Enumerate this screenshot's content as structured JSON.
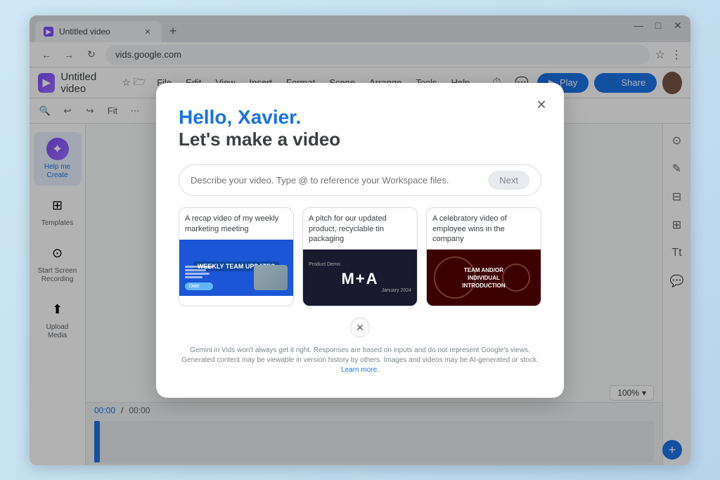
{
  "browser": {
    "tab_title": "Untitled video",
    "tab_favicon": "▶",
    "address": "vids.google.com",
    "new_tab_icon": "+",
    "minimize": "—",
    "maximize": "□",
    "close": "✕",
    "back": "←",
    "forward": "→",
    "refresh": "↻",
    "star_icon": "☆",
    "more_icon": "⋮"
  },
  "app": {
    "logo_text": "▶",
    "title": "Untitled video",
    "history_icon": "⏱",
    "comments_icon": "💬",
    "play_label": "Play",
    "share_label": "Share",
    "menu_items": [
      "File",
      "Edit",
      "View",
      "Insert",
      "Format",
      "Scene",
      "Arrange",
      "Tools",
      "Help"
    ]
  },
  "format_bar": {
    "undo_icon": "↩",
    "redo_icon": "↪",
    "fit_label": "Fit"
  },
  "sidebar": {
    "items": [
      {
        "id": "help-create",
        "label": "Help me\nCreate",
        "icon": "✦",
        "active": true
      },
      {
        "id": "templates",
        "label": "Templates",
        "icon": "⊞",
        "active": false
      },
      {
        "id": "screen-recording",
        "label": "Start Screen\nRecording",
        "icon": "⊙",
        "active": false
      },
      {
        "id": "upload-media",
        "label": "Upload\nMedia",
        "icon": "⬆",
        "active": false
      }
    ]
  },
  "right_sidebar": {
    "buttons": [
      "⊙",
      "✎",
      "⊟",
      "⊞",
      "Tt",
      "💬"
    ]
  },
  "timeline": {
    "current_time": "00:00",
    "total_time": "00:00",
    "zoom_level": "100%",
    "add_icon": "+"
  },
  "dialog": {
    "close_icon": "✕",
    "greeting": "Hello, Xavier.",
    "subtitle": "Let's make a video",
    "input_placeholder": "Describe your video. Type @ to reference your Workspace files.",
    "next_button": "Next",
    "suggestions": [
      {
        "label": "A recap video of my weekly marketing meeting",
        "thumb_type": "weekly-updates"
      },
      {
        "label": "A pitch for our updated product, recyclable tin packaging",
        "thumb_type": "product-demo"
      },
      {
        "label": "A celebratory video of employee wins in the company",
        "thumb_type": "team-intro"
      }
    ],
    "carousel_x_icon": "✕",
    "disclaimer": "Gemini in Vids won't always get it right. Responses are based on inputs and do not represent Google's views. Generated content may be viewable in version history by others. Images and videos may be AI-generated or stock.",
    "learn_more": "Learn more."
  }
}
